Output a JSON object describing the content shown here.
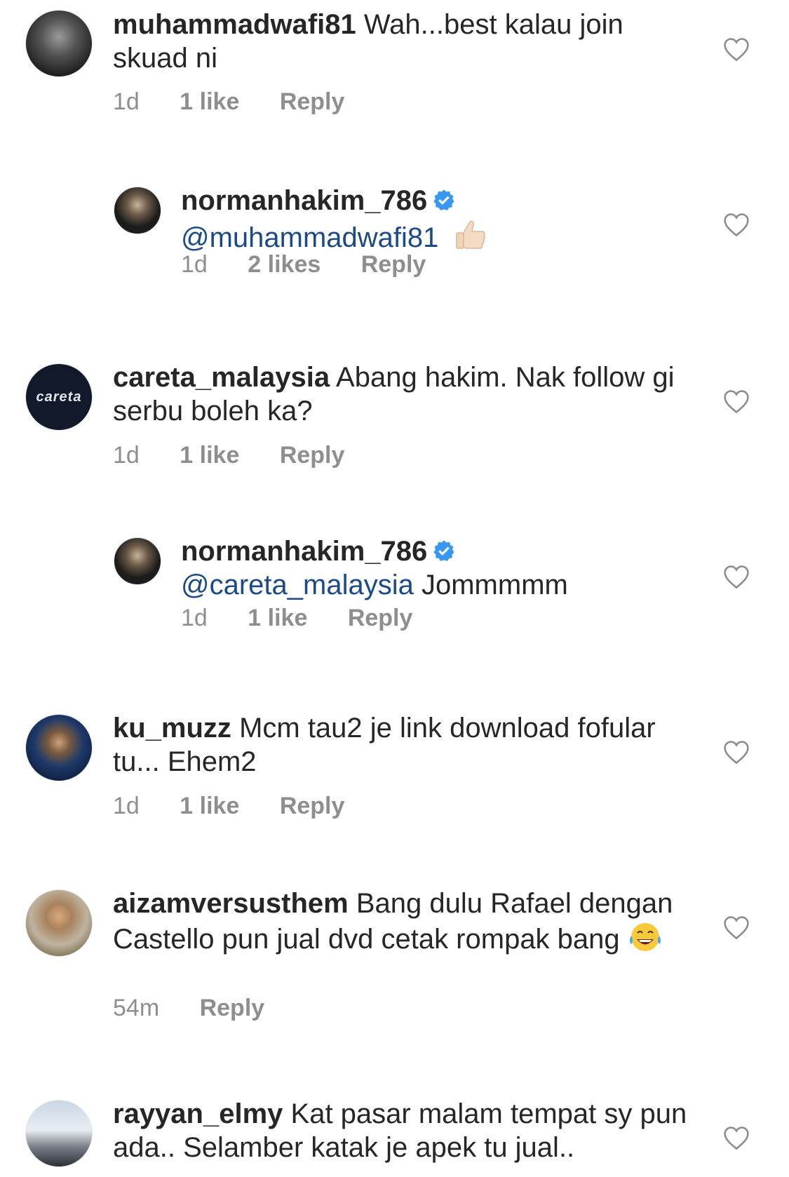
{
  "comments": [
    {
      "username": "muhammadwafi81",
      "text": "Wah...best kalau join skuad ni",
      "time": "1d",
      "likes": "1 like",
      "reply": "Reply"
    },
    {
      "username": "normanhakim_786",
      "verified": true,
      "mention": "@muhammadwafi81",
      "text": "",
      "emoji": "thumbs-up",
      "time": "1d",
      "likes": "2 likes",
      "reply": "Reply"
    },
    {
      "username": "careta_malaysia",
      "text": "Abang hakim. Nak follow gi serbu boleh ka?",
      "time": "1d",
      "likes": "1 like",
      "reply": "Reply"
    },
    {
      "username": "normanhakim_786",
      "verified": true,
      "mention": "@careta_malaysia",
      "text": "Jommmmm",
      "time": "1d",
      "likes": "1 like",
      "reply": "Reply"
    },
    {
      "username": "ku_muzz",
      "text": "Mcm tau2 je link download fofular tu... Ehem2",
      "time": "1d",
      "likes": "1 like",
      "reply": "Reply"
    },
    {
      "username": "aizamversusthem",
      "text": "Bang dulu Rafael dengan Castello pun jual dvd cetak rompak bang",
      "emoji": "tears-of-joy",
      "time": "54m",
      "reply": "Reply"
    },
    {
      "username": "rayyan_elmy",
      "text": "Kat pasar malam tempat sy pun ada.. Selamber katak je apek tu jual.."
    }
  ],
  "avatars": {
    "careta_logo_text": "careta"
  },
  "colors": {
    "text": "#262626",
    "meta": "#8e8e8e",
    "mention": "#1a4a8a",
    "verified": "#3897f0"
  }
}
